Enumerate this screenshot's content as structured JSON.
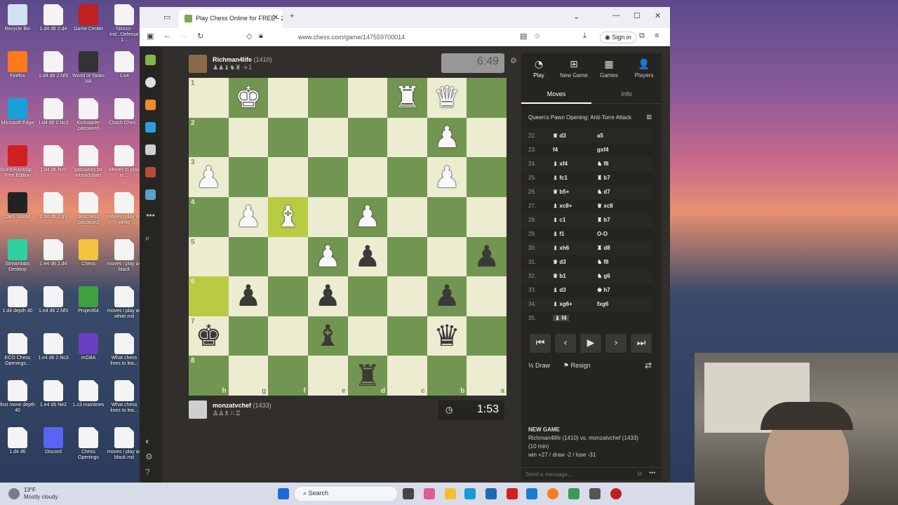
{
  "desktop": {
    "icons": [
      {
        "label": "Recycle Bin",
        "icon": "recycle-bin-icon",
        "color": "#cfe3f5"
      },
      {
        "label": "1.d4 d6 2.d4",
        "icon": "file-icon",
        "color": "#f4f4f4"
      },
      {
        "label": "Game Center",
        "icon": "game-center-icon",
        "color": "#c02020"
      },
      {
        "label": "Nimzo-Ind...Defense 1...",
        "icon": "file-icon",
        "color": "#f4f4f4"
      },
      {
        "label": "Firefox",
        "icon": "firefox-icon",
        "color": "#ff7a1a"
      },
      {
        "label": "1.d4 d6 2.Nf3",
        "icon": "file-icon",
        "color": "#f4f4f4"
      },
      {
        "label": "World of Tanks NA",
        "icon": "world-of-tanks-icon",
        "color": "#333333"
      },
      {
        "label": "1.e4",
        "icon": "file-icon",
        "color": "#f4f4f4"
      },
      {
        "label": "Microsoft Edge",
        "icon": "edge-icon",
        "color": "#1aa0d8"
      },
      {
        "label": "1.d4 d6 2.Nc3",
        "icon": "file-icon",
        "color": "#f4f4f4"
      },
      {
        "label": "Kickstarter password",
        "icon": "file-icon",
        "color": "#f4f4f4"
      },
      {
        "label": "Clutch Ches...",
        "icon": "file-icon",
        "color": "#f4f4f4"
      },
      {
        "label": "SUPERAntiSp... Free Edition",
        "icon": "superantispyware-icon",
        "color": "#d02020"
      },
      {
        "label": "1.d4 d6 Nc2",
        "icon": "file-icon",
        "color": "#f4f4f4"
      },
      {
        "label": "password for inboxdollars",
        "icon": "file-icon",
        "color": "#f4f4f4"
      },
      {
        "label": "Moves to play in ...",
        "icon": "file-icon",
        "color": "#f4f4f4"
      },
      {
        "label": "OBS Studio",
        "icon": "obs-icon",
        "color": "#222222"
      },
      {
        "label": "1.d4 d6 2.g3",
        "icon": "file-icon",
        "color": "#f4f4f4"
      },
      {
        "label": "365chess password",
        "icon": "file-icon",
        "color": "#f4f4f4"
      },
      {
        "label": "moves i play as white",
        "icon": "file-icon",
        "color": "#f4f4f4"
      },
      {
        "label": "Streamlabs Desktop",
        "icon": "streamlabs-icon",
        "color": "#30d0a0"
      },
      {
        "label": "1.e4 d6 2.d4",
        "icon": "file-icon",
        "color": "#f4f4f4"
      },
      {
        "label": "Chess",
        "icon": "folder-icon",
        "color": "#f2c440"
      },
      {
        "label": "moves i play as black",
        "icon": "file-icon",
        "color": "#f4f4f4"
      },
      {
        "label": "1.d4 depth 40",
        "icon": "file-icon",
        "color": "#f4f4f4"
      },
      {
        "label": "1.e4 d6 2.Nf3",
        "icon": "file-icon",
        "color": "#f4f4f4"
      },
      {
        "label": "Project64",
        "icon": "project64-icon",
        "color": "#40a040"
      },
      {
        "label": "moves i play as white.md",
        "icon": "file-icon",
        "color": "#f4f4f4"
      },
      {
        "label": "ECO Chess Openings...",
        "icon": "file-icon",
        "color": "#f4f4f4"
      },
      {
        "label": "1.e4 d6 2.Nc3",
        "icon": "file-icon",
        "color": "#f4f4f4"
      },
      {
        "label": "mGBA",
        "icon": "mgba-icon",
        "color": "#6a40c0"
      },
      {
        "label": "What chess lines to lea...",
        "icon": "file-icon",
        "color": "#f4f4f4"
      },
      {
        "label": "first move depth 40",
        "icon": "file-icon",
        "color": "#f4f4f4"
      },
      {
        "label": "1.e4 d6 Ne2",
        "icon": "file-icon",
        "color": "#f4f4f4"
      },
      {
        "label": "1.c3 mainlines",
        "icon": "file-icon",
        "color": "#f4f4f4"
      },
      {
        "label": "What chess lines to lea...",
        "icon": "file-icon",
        "color": "#f4f4f4"
      },
      {
        "label": "1.d4 d6",
        "icon": "file-icon",
        "color": "#f4f4f4"
      },
      {
        "label": "Discord",
        "icon": "discord-icon",
        "color": "#5865f2"
      },
      {
        "label": "Chess Openings",
        "icon": "file-icon",
        "color": "#f4f4f4"
      },
      {
        "label": "moves i play as black.md",
        "icon": "file-icon",
        "color": "#f4f4f4"
      }
    ]
  },
  "browser": {
    "tab_title": "Play Chess Online for FREE - 2 P...",
    "url": "www.chess.com/game/147559700014",
    "signin_label": "Sign in"
  },
  "game": {
    "top_player": {
      "name": "Richman4life",
      "rating": "(1410)",
      "captured": "♟♟♝♞♜ +1",
      "clock": "6:49"
    },
    "bottom_player": {
      "name": "monzatvchef",
      "rating": "(1433)",
      "captured": "♙♙♗♘♖",
      "clock": "1:53"
    },
    "files_bottom": [
      "h",
      "g",
      "f",
      "e",
      "d",
      "c",
      "b",
      "a"
    ],
    "ranks_left": [
      "1",
      "2",
      "3",
      "4",
      "5",
      "6",
      "7",
      "8"
    ],
    "board": [
      [
        "",
        "wk",
        "",
        "",
        "",
        "wr",
        "wq",
        ""
      ],
      [
        "",
        "",
        "",
        "",
        "",
        "",
        "wp",
        ""
      ],
      [
        "wp",
        "",
        "",
        "",
        "",
        "",
        "wp",
        ""
      ],
      [
        "",
        "wp",
        "wb",
        "",
        "wp",
        "",
        "",
        ""
      ],
      [
        "",
        "",
        "",
        "wp",
        "bp",
        "",
        "",
        "bp"
      ],
      [
        "",
        "bp",
        "",
        "bp",
        "",
        "",
        "bp",
        ""
      ],
      [
        "bk",
        "",
        "",
        "bb",
        "",
        "",
        "bq",
        ""
      ],
      [
        "",
        "",
        "",
        "",
        "br",
        "",
        "",
        ""
      ]
    ],
    "highlighted": [
      [
        3,
        2
      ],
      [
        5,
        0
      ]
    ],
    "colors": {
      "light": "#ebecd0",
      "dark": "#739552",
      "highlight": "#b9ca43",
      "highlight_light": "#f5f682"
    }
  },
  "panel": {
    "tabs": [
      {
        "label": "Play",
        "icon": "clock-icon",
        "glyph": "◔"
      },
      {
        "label": "New Game",
        "icon": "plus-icon",
        "glyph": "⊞"
      },
      {
        "label": "Games",
        "icon": "board-icon",
        "glyph": "▦"
      },
      {
        "label": "Players",
        "icon": "players-icon",
        "glyph": "👤"
      }
    ],
    "subtabs": {
      "moves": "Moves",
      "info": "Info"
    },
    "opening": "Queen's Pawn Opening: Anti-Torre Attack",
    "moves": [
      {
        "n": "22.",
        "w": "♛ d3",
        "b": "a5"
      },
      {
        "n": "23.",
        "w": "f4",
        "b": "gxf4"
      },
      {
        "n": "24.",
        "w": "♝ xf4",
        "b": "♞ f8"
      },
      {
        "n": "25.",
        "w": "♝ fc1",
        "b": "♜ b7"
      },
      {
        "n": "26.",
        "w": "♛ b5+",
        "b": "♞ d7"
      },
      {
        "n": "27.",
        "w": "♝ xc8+",
        "b": "♛ xc8"
      },
      {
        "n": "28.",
        "w": "♝ c1",
        "b": "♜ b7"
      },
      {
        "n": "29.",
        "w": "♝ f1",
        "b": "O-O"
      },
      {
        "n": "30.",
        "w": "♝ xh6",
        "b": "♜ d8"
      },
      {
        "n": "31.",
        "w": "♛ d3",
        "b": "♞ f8"
      },
      {
        "n": "32.",
        "w": "♛ b1",
        "b": "♞ g6"
      },
      {
        "n": "33.",
        "w": "♝ d3",
        "b": "♚ h7"
      },
      {
        "n": "34.",
        "w": "♝ xg6+",
        "b": "fxg6"
      },
      {
        "n": "35.",
        "w": "♝ f4",
        "b": ""
      }
    ],
    "draw_label": "Draw",
    "resign_label": "Resign",
    "new_game_title": "NEW GAME",
    "new_game_line": "Richman4life (1410) vs. monzatvchef (1433)",
    "new_game_time": "(10 min)",
    "new_game_stats": "win +27 / draw -2 / lose -31",
    "chat_placeholder": "Send a message..."
  },
  "taskbar": {
    "weather_temp": "13°F",
    "weather_desc": "Mostly cloudy",
    "search_label": "Search"
  }
}
